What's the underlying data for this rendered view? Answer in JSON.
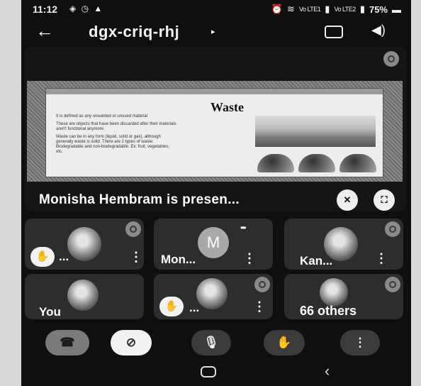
{
  "status_bar": {
    "time": "11:12",
    "notification_icons": "◈ ◷ ▲",
    "network_label": "Vo LTE1",
    "network_label_2": "Vo LTE2",
    "battery_percent": "75%"
  },
  "header": {
    "back_glyph": "←",
    "meeting_code": "dgx-criq-rhj",
    "caret_glyph": "▸",
    "speaker_glyph": "◀)"
  },
  "presentation": {
    "slide_title": "Waste",
    "slide_bullets": [
      "It is defined as any unwanted or unused material",
      "These are objects that have been discarded after their materials aren't functional anymore",
      "Waste can be in any form (liquid, solid or gas), although generally waste is solid. There are 2 types of waste: Biodegradable and non-biodegradable. Ex: fruit, vegetables, etc."
    ],
    "presenting_text": "Monisha Hembram is presen...",
    "presenter_control_glyph": "✕",
    "fullscreen_glyph": "⛶"
  },
  "participants": [
    {
      "name": "...",
      "hand_raised": true,
      "avatar": "photo"
    },
    {
      "name": "Mon...",
      "hand_raised": false,
      "avatar": "letter",
      "initial": "M"
    },
    {
      "name": "Kan...",
      "hand_raised": false,
      "avatar": "photo"
    },
    {
      "name": "You",
      "hand_raised": false,
      "avatar": "photo"
    },
    {
      "name": "...",
      "hand_raised": true,
      "avatar": "photo"
    },
    {
      "name": "66 others",
      "hand_raised": false,
      "avatar": "photo"
    }
  ],
  "glyphs": {
    "hand": "✋",
    "kebab": "⋮",
    "speaking_dots": "•••"
  },
  "controls": {
    "end_call_glyph": "☎",
    "camera_off_glyph": "⊘",
    "mic_glyph": "🎙",
    "raise_hand_glyph": "✋",
    "more_glyph": "⋮"
  },
  "colors": {
    "end_call": "#7a7a7a",
    "camera_button": "#f2f2f2",
    "control_dark": "#3b3b3b"
  }
}
